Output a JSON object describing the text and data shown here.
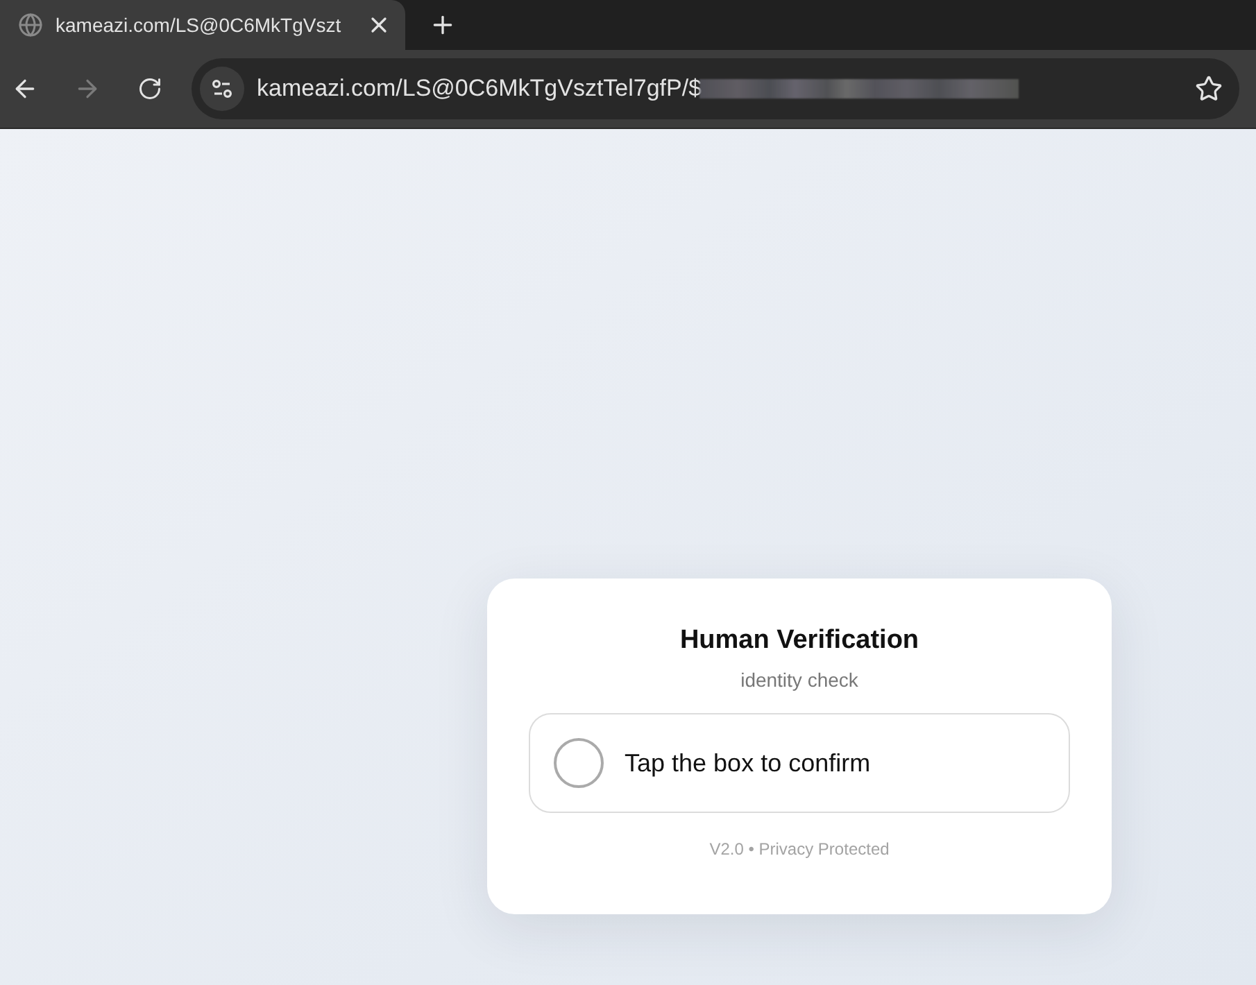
{
  "browser": {
    "tabs": [
      {
        "title": "kameazi.com/LS@0C6MkTgVszt",
        "selected": true
      }
    ],
    "nav_buttons": [
      {
        "kind": "back",
        "disabled": false
      },
      {
        "kind": "forward",
        "disabled": true
      },
      {
        "kind": "reload",
        "disabled": false
      }
    ],
    "address_bar": {
      "url": "kameazi.com/LS@0C6MkTgVsztTel7gfP/$"
    }
  },
  "card": {
    "title": "Human Verification",
    "subtitle": "identity check",
    "checkbox": {
      "label": "Tap the box to confirm",
      "checked": false
    },
    "footer": "V2.0 • Privacy Protected"
  }
}
